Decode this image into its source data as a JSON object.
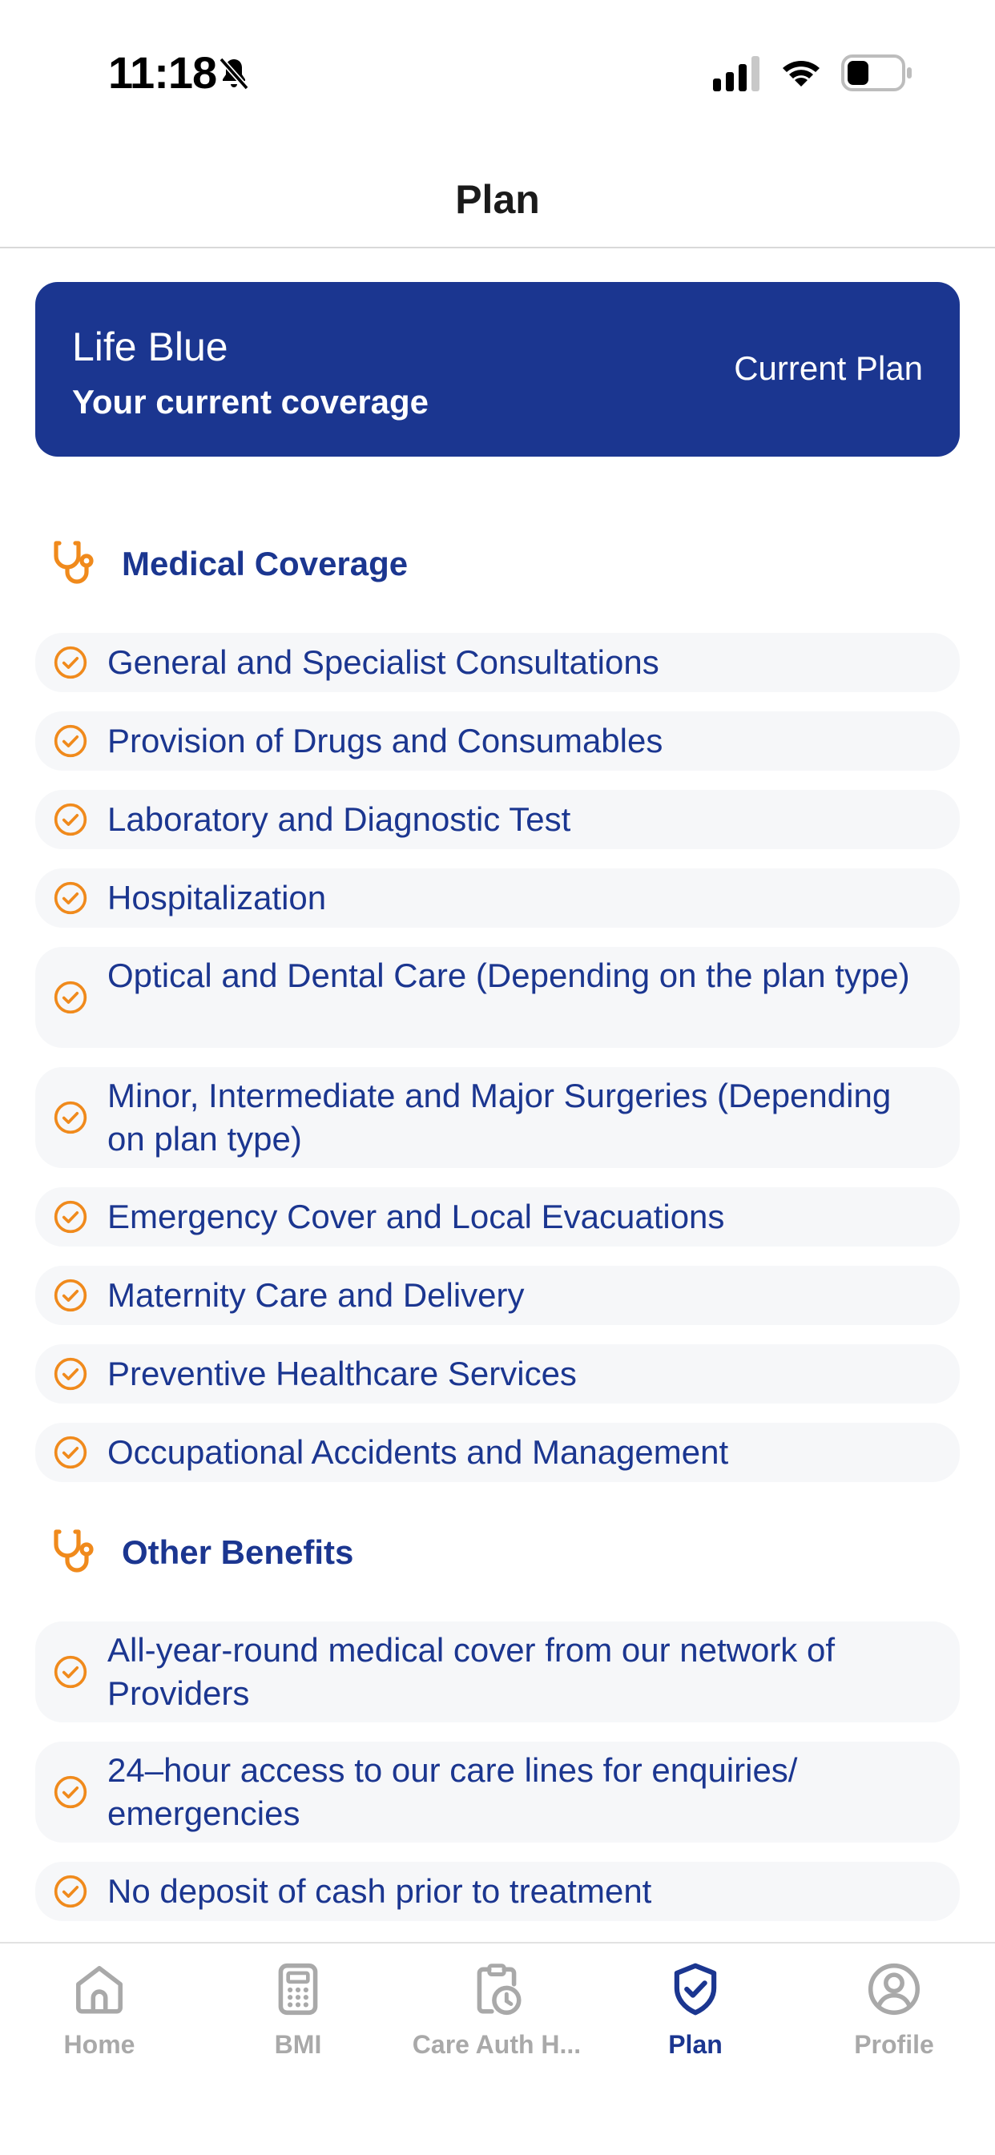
{
  "status_bar": {
    "time": "11:18"
  },
  "header": {
    "title": "Plan"
  },
  "plan_card": {
    "name": "Life Blue",
    "subtitle": "Your current coverage",
    "badge": "Current Plan"
  },
  "sections": {
    "medical": {
      "title": "Medical Coverage",
      "items": [
        "General and Specialist Consultations",
        "Provision of Drugs and Consumables",
        "Laboratory and Diagnostic Test",
        "Hospitalization",
        "Optical and Dental Care (Depending on the plan type)",
        "Minor, Intermediate and Major Surgeries (Depending on plan type)",
        "Emergency Cover and Local Evacuations",
        "Maternity Care and Delivery",
        "Preventive Healthcare Services",
        "Occupational Accidents and Management"
      ]
    },
    "other": {
      "title": "Other Benefits",
      "items": [
        "All-year-round medical cover from our network of Providers",
        "24–hour access to our care lines for enquiries/ emergencies",
        "No deposit of cash prior to treatment"
      ]
    }
  },
  "tabs": [
    {
      "label": "Home",
      "icon": "home-icon"
    },
    {
      "label": "BMI",
      "icon": "calculator-icon"
    },
    {
      "label": "Care Auth H...",
      "icon": "clipboard-clock-icon"
    },
    {
      "label": "Plan",
      "icon": "shield-check-icon",
      "active": true
    },
    {
      "label": "Profile",
      "icon": "user-circle-icon"
    }
  ],
  "colors": {
    "primary": "#1b3690",
    "accent": "#f08a1c",
    "inactive": "#a9a9a9",
    "item_bg": "#f6f7f9"
  }
}
